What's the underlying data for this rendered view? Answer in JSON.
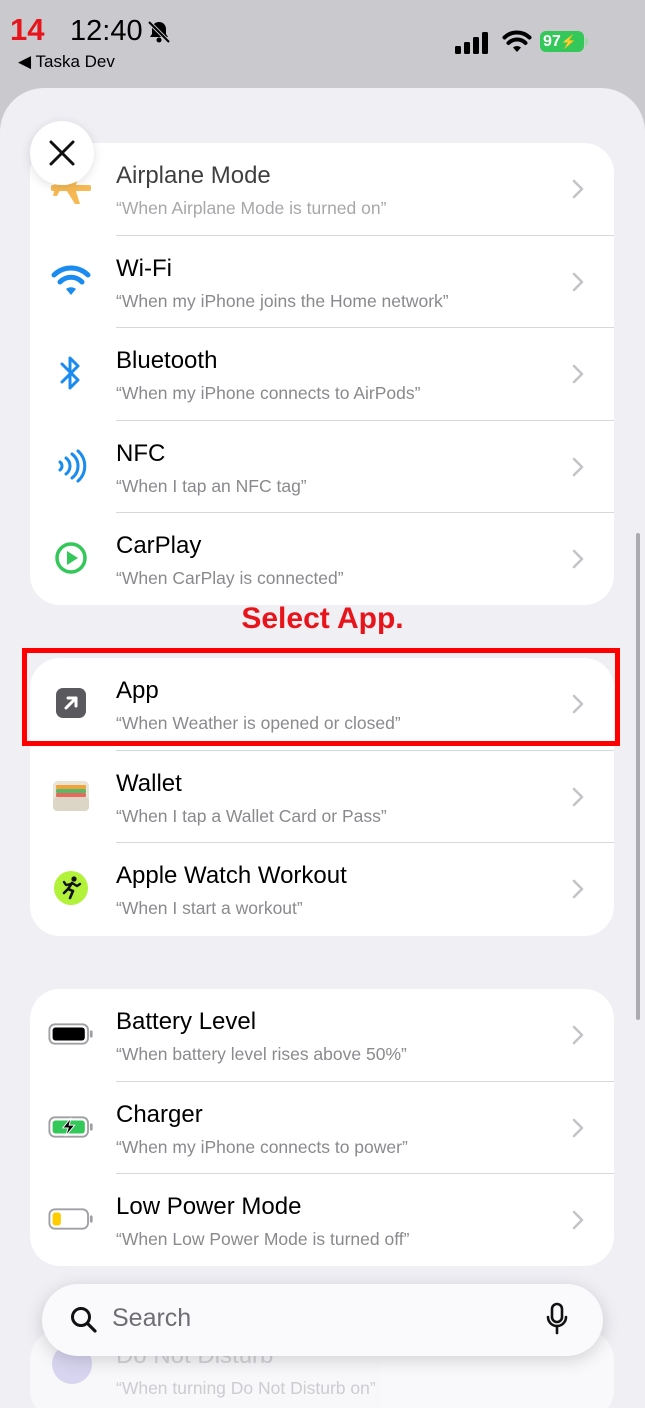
{
  "status": {
    "step": "14",
    "time": "12:40",
    "back_app": "◀ Taska Dev",
    "battery": "97"
  },
  "annotation": {
    "label": "Select App."
  },
  "groups": [
    {
      "items": [
        {
          "key": "airplane",
          "icon": "airplane-icon",
          "title": "Airplane Mode",
          "subtitle": "“When Airplane Mode is turned on”"
        },
        {
          "key": "wifi",
          "icon": "wifi-icon",
          "title": "Wi-Fi",
          "subtitle": "“When my iPhone joins the Home network”"
        },
        {
          "key": "bluetooth",
          "icon": "bluetooth-icon",
          "title": "Bluetooth",
          "subtitle": "“When my iPhone connects to AirPods”"
        },
        {
          "key": "nfc",
          "icon": "nfc-icon",
          "title": "NFC",
          "subtitle": "“When I tap an NFC tag”"
        },
        {
          "key": "carplay",
          "icon": "carplay-icon",
          "title": "CarPlay",
          "subtitle": "“When CarPlay is connected”"
        }
      ]
    },
    {
      "items": [
        {
          "key": "app",
          "icon": "app-arrow-icon",
          "title": "App",
          "subtitle": "“When Weather is opened or closed”"
        },
        {
          "key": "wallet",
          "icon": "wallet-icon",
          "title": "Wallet",
          "subtitle": "“When I tap a Wallet Card or Pass”"
        },
        {
          "key": "workout",
          "icon": "workout-icon",
          "title": "Apple Watch Workout",
          "subtitle": "“When I start a workout”"
        }
      ]
    },
    {
      "items": [
        {
          "key": "battery-level",
          "icon": "battery-level-icon",
          "title": "Battery Level",
          "subtitle": "“When battery level rises above 50%”"
        },
        {
          "key": "charger",
          "icon": "charger-icon",
          "title": "Charger",
          "subtitle": "“When my iPhone connects to power”"
        },
        {
          "key": "low-power",
          "icon": "low-power-icon",
          "title": "Low Power Mode",
          "subtitle": "“When Low Power Mode is turned off”"
        }
      ]
    }
  ],
  "peek_item": {
    "title": "Do Not Disturb",
    "subtitle": "“When turning Do Not Disturb on”"
  },
  "search": {
    "placeholder": "Search"
  },
  "colors": {
    "accent_blue": "#1a8cf0",
    "carplay_green": "#34c759",
    "annotation_red": "#e8141b"
  }
}
